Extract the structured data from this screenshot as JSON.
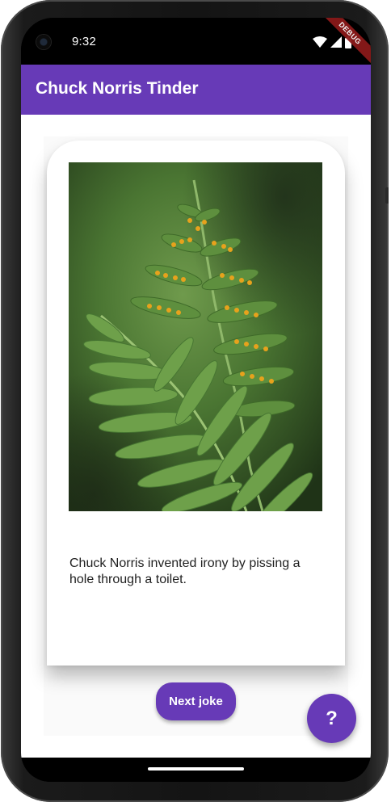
{
  "status_bar": {
    "time": "9:32",
    "icons": [
      "wifi-icon",
      "cell-signal-icon",
      "battery-icon"
    ],
    "debug_label": "DEBUG"
  },
  "app_bar": {
    "title": "Chuck Norris Tinder",
    "color": "#673ab7"
  },
  "card": {
    "image_icon": "fern-photo",
    "joke_text": "Chuck Norris invented irony by pissing a hole through a toilet."
  },
  "actions": {
    "next_joke_label": "Next joke",
    "fab_label": "?"
  },
  "colors": {
    "accent": "#673ab7",
    "background": "#fafafa"
  }
}
